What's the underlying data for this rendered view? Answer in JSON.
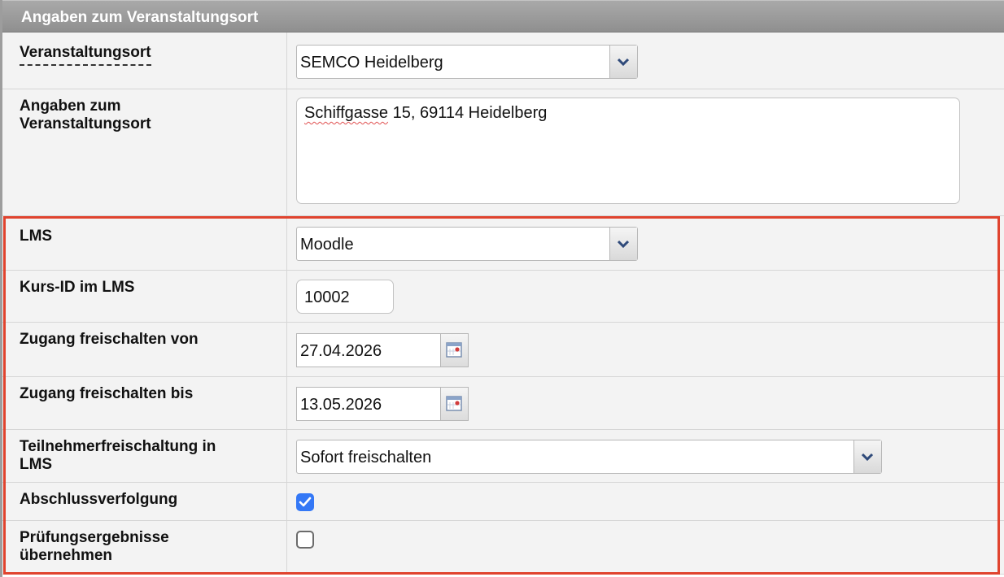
{
  "section": {
    "title": "Angaben zum Veranstaltungsort"
  },
  "fields": {
    "venue": {
      "label": "Veranstaltungsort",
      "value": "SEMCO Heidelberg"
    },
    "venue_details": {
      "label_line1": "Angaben zum",
      "label_line2": "Veranstaltungsort",
      "value_part1": "Schiffgasse",
      "value_part2": " 15, 69114 Heidelberg"
    },
    "lms": {
      "label": "LMS",
      "value": "Moodle"
    },
    "course_id": {
      "label": "Kurs-ID im LMS",
      "value": "10002"
    },
    "access_from": {
      "label": "Zugang freischalten von",
      "value": "27.04.2026"
    },
    "access_to": {
      "label": "Zugang freischalten bis",
      "value": "13.05.2026"
    },
    "participant_activation": {
      "label_line1": "Teilnehmerfreischaltung in",
      "label_line2": "LMS",
      "value": "Sofort freischalten"
    },
    "completion_tracking": {
      "label": "Abschlussverfolgung",
      "checked": true
    },
    "exam_results": {
      "label_line1": "Prüfungsergebnisse",
      "label_line2": "übernehmen",
      "checked": false
    }
  },
  "colors": {
    "highlight": "#e0432e",
    "checkbox_checked": "#3478f6",
    "header_bg": "#9b9b9b",
    "row_bg": "#f3f3f3"
  },
  "icons": {
    "dropdown": "chevron-down-icon",
    "calendar": "calendar-icon",
    "check": "checkmark-icon"
  }
}
